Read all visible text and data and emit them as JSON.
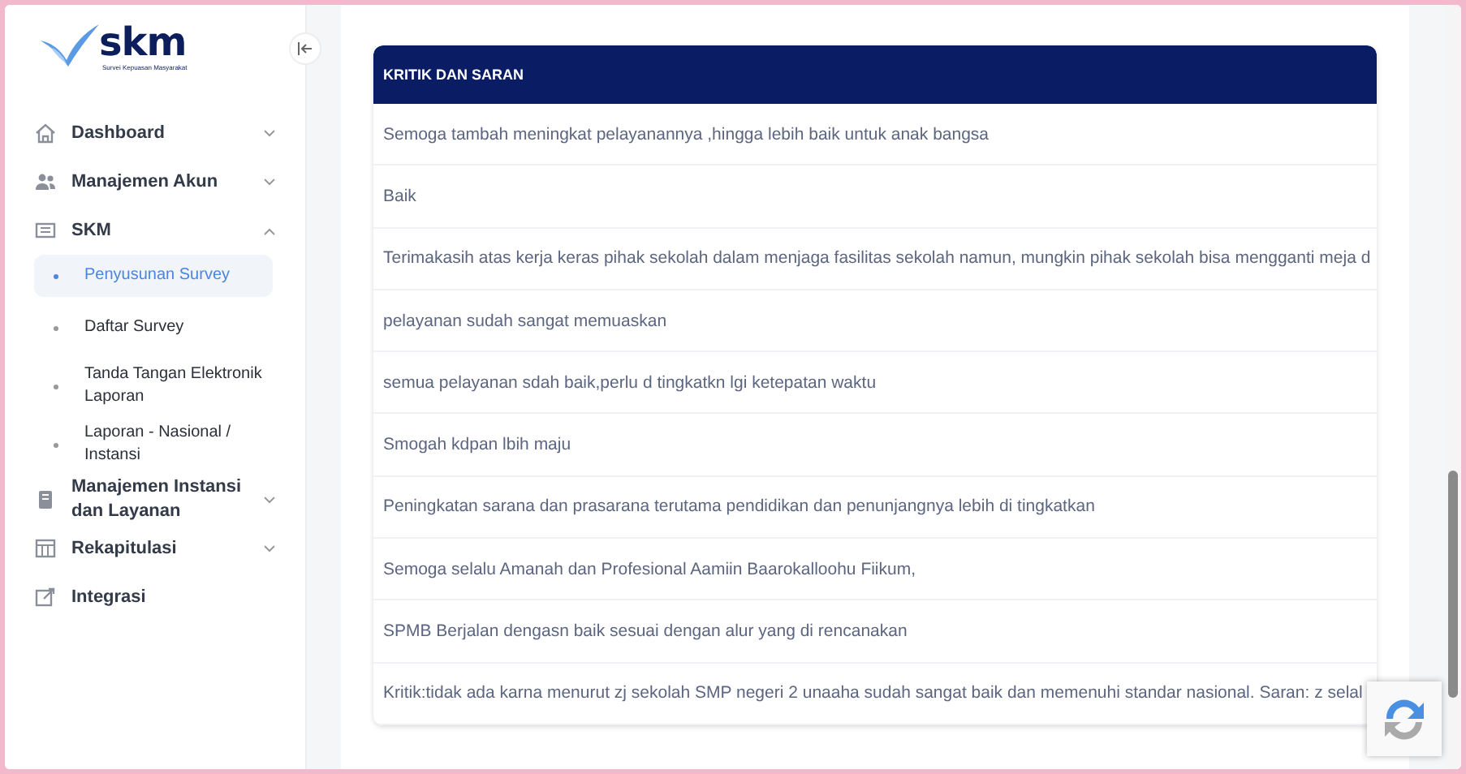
{
  "logo": {
    "name": "skm",
    "subtitle": "Survei Kepuasan Masyarakat"
  },
  "sidebar": {
    "items": [
      {
        "kind": "group",
        "label": "Dashboard",
        "expanded": false
      },
      {
        "kind": "group",
        "label": "Manajemen Akun",
        "expanded": false
      },
      {
        "kind": "group",
        "label": "SKM",
        "expanded": true,
        "children": [
          {
            "label": "Penyusunan Survey",
            "selected": true
          },
          {
            "label": "Daftar Survey",
            "selected": false
          },
          {
            "label": "Tanda Tangan Elektronik Laporan",
            "selected": false
          },
          {
            "label": "Laporan - Nasional / Instansi",
            "selected": false
          }
        ]
      },
      {
        "kind": "group",
        "label": "Manajemen Instansi dan Layanan",
        "expanded": false
      },
      {
        "kind": "group",
        "label": "Rekapitulasi",
        "expanded": false
      },
      {
        "kind": "link",
        "label": "Integrasi"
      }
    ]
  },
  "table": {
    "columns": [
      "KRITIK DAN SARAN"
    ],
    "rows": [
      "Semoga tambah meningkat pelayanannya ,hingga lebih baik untuk anak bangsa",
      "Baik",
      "Terimakasih atas kerja keras pihak sekolah dalam menjaga fasilitas sekolah namun, mungkin pihak sekolah bisa mengganti meja d",
      "pelayanan sudah sangat memuaskan",
      "semua pelayanan sdah baik,perlu d tingkatkn lgi ketepatan waktu",
      "Smogah kdpan lbih maju",
      "Peningkatan sarana dan prasarana terutama pendidikan dan penunjangnya lebih di tingkatkan",
      "Semoga selalu Amanah dan Profesional Aamiin Baarokalloohu Fiikum,",
      "SPMB Berjalan dengasn baik sesuai dengan alur yang di rencanakan",
      "Kritik:tidak ada karna menurut zj sekolah SMP negeri 2 unaaha sudah sangat baik dan memenuhi standar nasional. Saran: z selal"
    ]
  }
}
